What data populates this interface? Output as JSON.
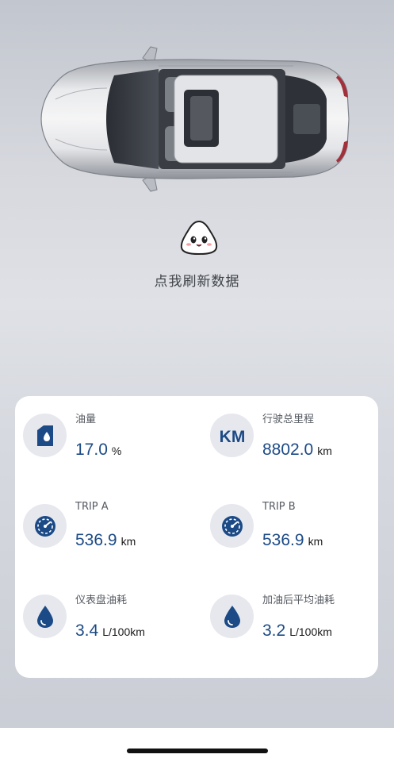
{
  "refresh_label": "点我刷新数据",
  "colors": {
    "accent": "#1c4a86",
    "card": "#ffffff",
    "icon_bg": "#e6e8ee"
  },
  "stats": [
    {
      "label": "油量",
      "value": "17.0",
      "unit": "%",
      "icon": "fuel-can-icon"
    },
    {
      "label": "行驶总里程",
      "value": "8802.0",
      "unit": "km",
      "icon": "km-icon"
    },
    {
      "label": "TRIP A",
      "value": "536.9",
      "unit": "km",
      "icon": "speedometer-icon"
    },
    {
      "label": "TRIP B",
      "value": "536.9",
      "unit": "km",
      "icon": "speedometer-icon"
    },
    {
      "label": "仪表盘油耗",
      "value": "3.4",
      "unit": "L/100km",
      "icon": "fuel-drop-icon"
    },
    {
      "label": "加油后平均油耗",
      "value": "3.2",
      "unit": "L/100km",
      "icon": "fuel-drop-icon"
    }
  ]
}
